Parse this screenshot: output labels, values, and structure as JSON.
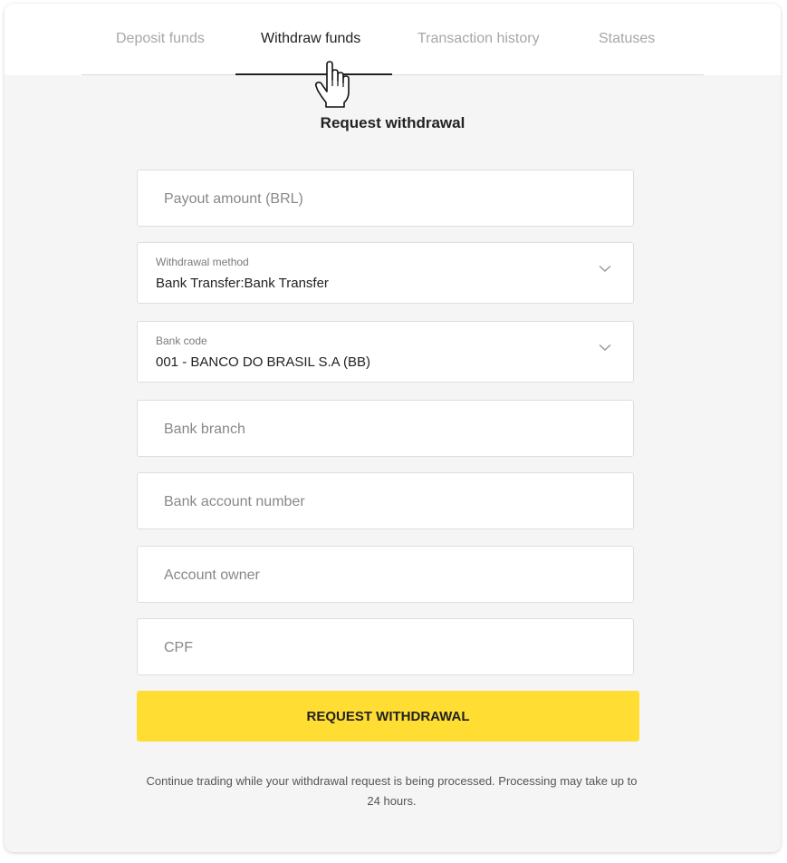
{
  "tabs": [
    {
      "label": "Deposit funds",
      "active": false
    },
    {
      "label": "Withdraw funds",
      "active": true
    },
    {
      "label": "Transaction history",
      "active": false
    },
    {
      "label": "Statuses",
      "active": false
    }
  ],
  "form": {
    "title": "Request withdrawal",
    "payout_amount": {
      "placeholder": "Payout amount (BRL)",
      "value": ""
    },
    "withdrawal_method": {
      "label": "Withdrawal method",
      "value": "Bank Transfer:Bank Transfer",
      "icon": "chevron-down-icon"
    },
    "bank_code": {
      "label": "Bank code",
      "value": "001 - BANCO DO BRASIL S.A (BB)",
      "icon": "chevron-down-icon"
    },
    "bank_branch": {
      "placeholder": "Bank branch",
      "value": ""
    },
    "bank_account_number": {
      "placeholder": "Bank account number",
      "value": ""
    },
    "account_owner": {
      "placeholder": "Account owner",
      "value": ""
    },
    "cpf": {
      "placeholder": "CPF",
      "value": ""
    },
    "submit_label": "REQUEST WITHDRAWAL",
    "note": "Continue trading while your withdrawal request is being processed.  Processing may take up to 24 hours."
  },
  "colors": {
    "accent": "#ffdd33",
    "panel_bg": "#f5f5f5",
    "active_tab": "#222222",
    "inactive_tab": "#a7a7a7"
  },
  "cursor": {
    "icon": "hand-pointer-icon"
  }
}
